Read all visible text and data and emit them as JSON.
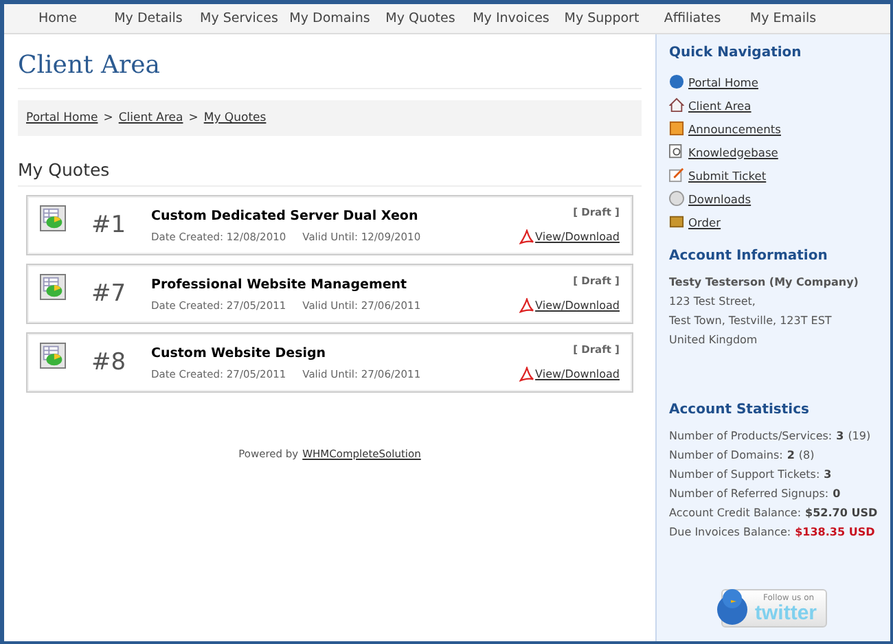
{
  "nav": [
    {
      "label": "Home",
      "selected": false
    },
    {
      "label": "My Details",
      "selected": false
    },
    {
      "label": "My Services",
      "selected": false
    },
    {
      "label": "My Domains",
      "selected": false
    },
    {
      "label": "My Quotes",
      "selected": false
    },
    {
      "label": "My Invoices",
      "selected": false
    },
    {
      "label": "My Support",
      "selected": false
    },
    {
      "label": "Affiliates",
      "selected": false
    },
    {
      "label": "My Emails",
      "selected": false
    }
  ],
  "page_title": "Client Area",
  "breadcrumb": [
    "Portal Home",
    "Client Area",
    "My Quotes"
  ],
  "breadcrumb_separator": ">",
  "section_title": "My Quotes",
  "quotes": [
    {
      "number": "#1",
      "subject": "Custom Dedicated Server Dual Xeon",
      "created": "Date Created: 12/08/2010",
      "valid": "Valid Until: 12/09/2010",
      "status": "[ Draft ]",
      "link": "View/Download"
    },
    {
      "number": "#7",
      "subject": "Professional Website Management",
      "created": "Date Created: 27/05/2011",
      "valid": "Valid Until: 27/06/2011",
      "status": "[ Draft ]",
      "link": "View/Download"
    },
    {
      "number": "#8",
      "subject": "Custom Website Design",
      "created": "Date Created: 27/05/2011",
      "valid": "Valid Until: 27/06/2011",
      "status": "[ Draft ]",
      "link": "View/Download"
    }
  ],
  "footer": {
    "text": "Powered by",
    "link": "WHMCompleteSolution"
  },
  "sidebar": {
    "quick_nav_title": "Quick Navigation",
    "quick_nav": [
      "Portal Home",
      "Client Area",
      "Announcements",
      "Knowledgebase",
      "Submit Ticket",
      "Downloads",
      "Order"
    ],
    "account_title": "Account Information",
    "account_name": "Testy Testerson (My Company)",
    "address": [
      "123 Test Street,",
      "Test Town, Testville, 123T EST",
      "United Kingdom"
    ],
    "stats_title": "Account Statistics",
    "stats": [
      {
        "label": "Number of Products/Services:",
        "value": "3",
        "extra": "(19)",
        "alert": false
      },
      {
        "label": "Number of Domains:",
        "value": "2",
        "extra": "(8)",
        "alert": false
      },
      {
        "label": "Number of Support Tickets:",
        "value": "3",
        "alert": false
      },
      {
        "label": "Number of Referred Signups:",
        "value": "0",
        "alert": false
      },
      {
        "label": "Account Credit Balance:",
        "value": "$52.70 USD",
        "alert": false
      },
      {
        "label": "Due Invoices Balance:",
        "value": "$138.35 USD",
        "alert": true
      }
    ],
    "twitter_badge": {
      "caption": "Follow us on",
      "brand": "twitter"
    }
  }
}
